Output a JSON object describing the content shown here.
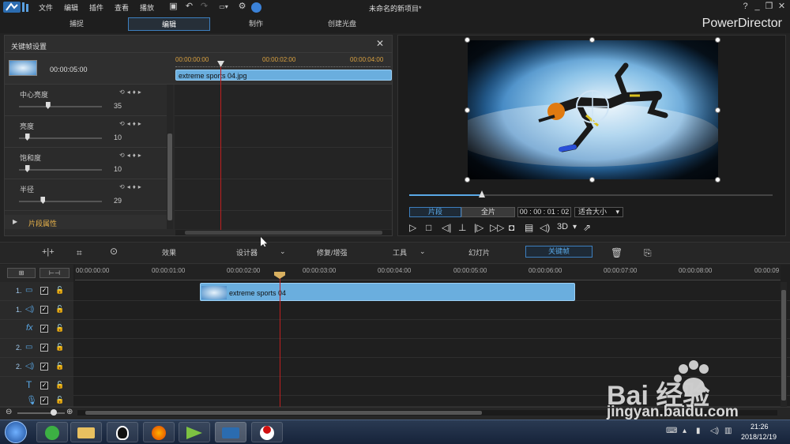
{
  "menu": {
    "file": "文件",
    "edit": "编辑",
    "plugins": "插件",
    "view": "查看",
    "play": "播放"
  },
  "window_title": "未命名的新项目*",
  "help": "?",
  "brand": "PowerDirector",
  "tabs": [
    "捕捉",
    "编辑",
    "制作",
    "创建光盘"
  ],
  "keyframe_panel": {
    "title": "关键帧设置",
    "clip_duration": "00:00:05:00",
    "ruler": [
      "00:00:00:00",
      "00:00:02:00",
      "00:00:04:00"
    ],
    "clip_name": "extreme sports 04.jpg",
    "properties": [
      {
        "label": "中心亮度",
        "value": "35",
        "level": 0.35
      },
      {
        "label": "亮度",
        "value": "10",
        "level": 0.1
      },
      {
        "label": "饱和度",
        "value": "10",
        "level": 0.1
      },
      {
        "label": "半径",
        "value": "29",
        "level": 0.29
      }
    ],
    "section": "片段属性"
  },
  "preview": {
    "mode_clip": "片段",
    "mode_full": "全片",
    "timecode": "00 : 00 : 01 : 02",
    "fit": "适合大小",
    "three_d": "3D",
    "progress": 0.2
  },
  "midbar": {
    "effects": "效果",
    "designer": "设计器",
    "repair": "修复/增强",
    "tools": "工具",
    "slideshow": "幻灯片",
    "keyframe": "关键帧"
  },
  "timeline": {
    "ruler": [
      "00:00:00:00",
      "00:00:01:00",
      "00:00:02:00",
      "00:00:03:00",
      "00:00:04:00",
      "00:00:05:00",
      "00:00:06:00",
      "00:00:07:00",
      "00:00:08:00",
      "00:00:09"
    ],
    "tracks": [
      "1.",
      "1.",
      "",
      "2.",
      "2.",
      "",
      ""
    ],
    "clip_label": "extreme sports 04"
  },
  "taskbar": {
    "time": "21:26",
    "date": "2018/12/19"
  },
  "watermark": {
    "brand": "Bai 经验",
    "url": "jingyan.baidu.com"
  },
  "colors": {
    "accent": "#3d7fbf",
    "playhead": "#c02020",
    "clip": "#6aaede"
  }
}
